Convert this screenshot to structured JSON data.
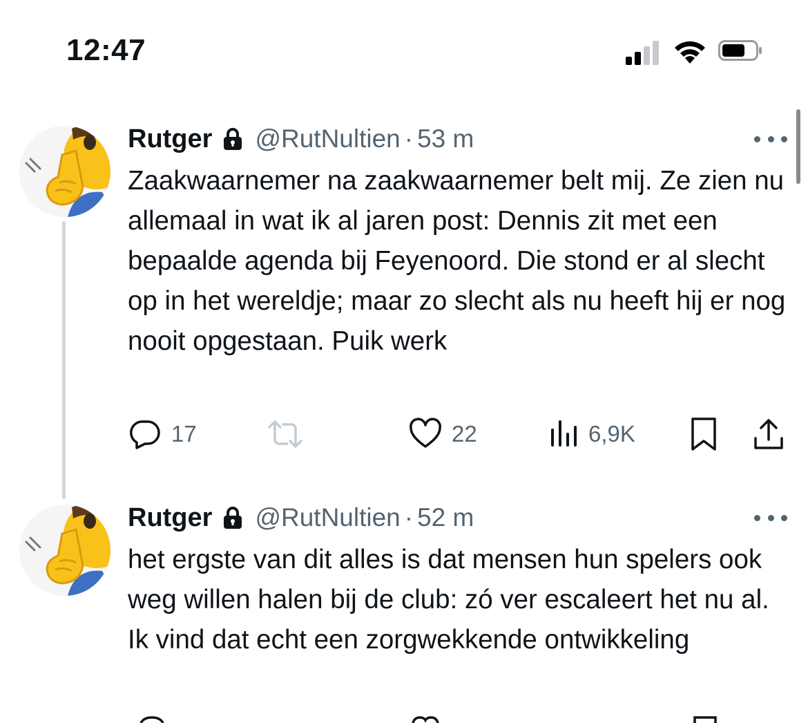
{
  "status_bar": {
    "time": "12:47",
    "icons": [
      "cellular-signal-icon",
      "wifi-icon",
      "battery-icon"
    ]
  },
  "colors": {
    "text": "#0f1419",
    "secondary": "#536471",
    "thread_line": "#cfd9de",
    "background": "#ffffff"
  },
  "tweets": [
    {
      "display_name": "Rutger",
      "protected_icon": "lock-icon",
      "handle": "@RutNultien",
      "separator": "·",
      "time": "53 m",
      "text": "Zaakwaarnemer na zaakwaarnemer belt mij. Ze zien nu allemaal in wat ik al jaren post: Dennis zit met een bepaalde agenda bij Feyenoord. Die stond er al slecht op in het wereldje; maar zo slecht als nu heeft hij er nog nooit opgestaan. Puik werk",
      "actions": {
        "replies": "17",
        "retweets": "",
        "likes": "22",
        "views": "6,9K"
      }
    },
    {
      "display_name": "Rutger",
      "protected_icon": "lock-icon",
      "handle": "@RutNultien",
      "separator": "·",
      "time": "52 m",
      "text": "het ergste van dit alles is dat mensen hun spelers ook weg willen halen bij de club: zó ver escaleert het nu al. Ik vind dat echt een zorgwekkende ontwikkeling"
    }
  ]
}
